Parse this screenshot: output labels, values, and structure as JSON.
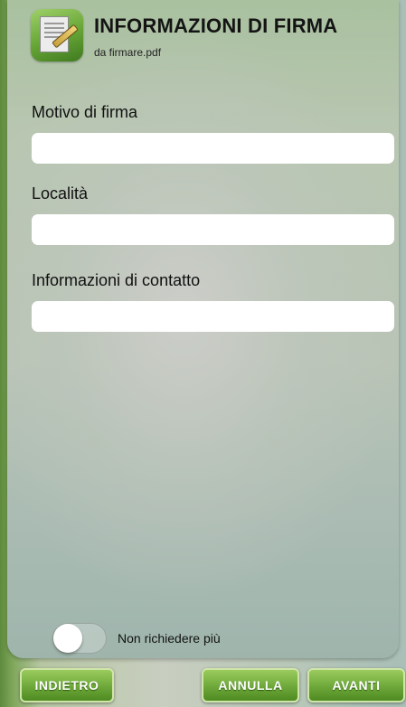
{
  "header": {
    "title": "INFORMAZIONI DI FIRMA",
    "subtitle": "da firmare.pdf",
    "icon": "signature-document-icon"
  },
  "form": {
    "reason_label": "Motivo di firma",
    "reason_value": "",
    "location_label": "Località",
    "location_value": "",
    "contact_label": "Informazioni di contatto",
    "contact_value": ""
  },
  "toggle": {
    "label": "Non richiedere più",
    "on": false
  },
  "buttons": {
    "back": "INDIETRO",
    "cancel": "ANNULLA",
    "next": "AVANTI"
  },
  "colors": {
    "button_green": "#6ea83a",
    "panel": "#b9c4b6"
  }
}
